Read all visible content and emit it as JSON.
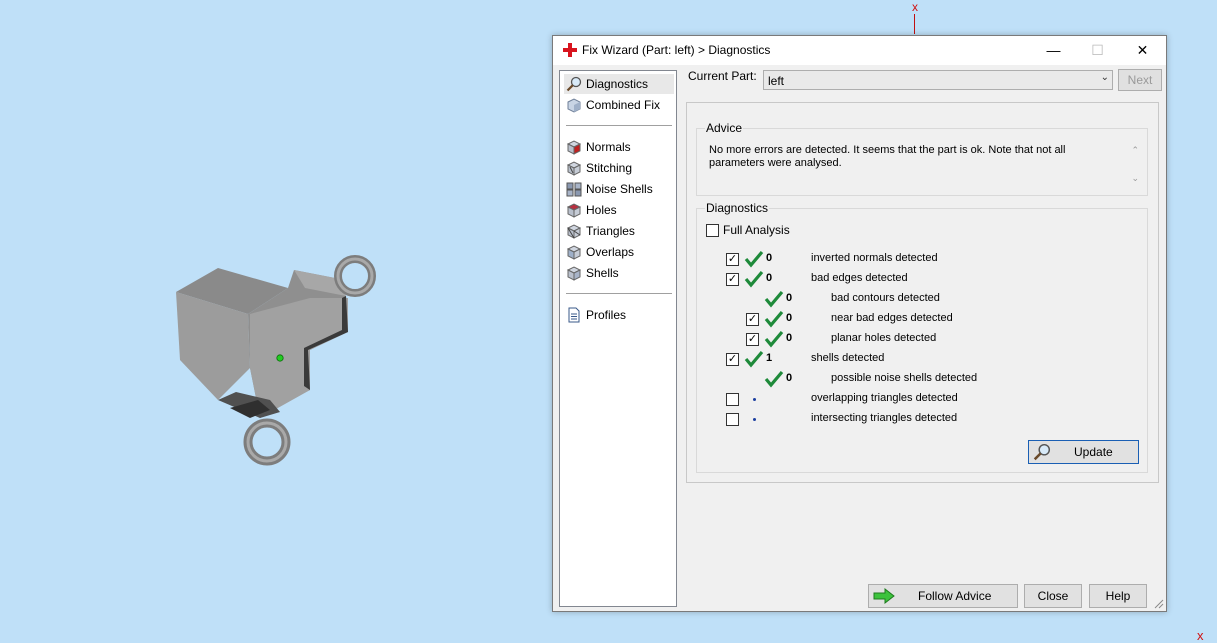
{
  "viewport": {
    "axis_top": "x",
    "axis_corner": "x"
  },
  "window": {
    "title": "Fix Wizard (Part: left) > Diagnostics",
    "controls": {
      "minimize": "—",
      "maximize": "☐",
      "close": "✕"
    }
  },
  "nav": {
    "items": [
      {
        "label": "Diagnostics",
        "icon": "magnifier-icon"
      },
      {
        "label": "Combined Fix",
        "icon": "combined-fix-icon"
      },
      {
        "label": "Normals",
        "icon": "normals-cube-icon"
      },
      {
        "label": "Stitching",
        "icon": "stitching-cube-icon"
      },
      {
        "label": "Noise Shells",
        "icon": "noise-shells-icon"
      },
      {
        "label": "Holes",
        "icon": "holes-cube-icon"
      },
      {
        "label": "Triangles",
        "icon": "triangles-cube-icon"
      },
      {
        "label": "Overlaps",
        "icon": "overlaps-cube-icon"
      },
      {
        "label": "Shells",
        "icon": "shells-cube-icon"
      },
      {
        "label": "Profiles",
        "icon": "profiles-document-icon"
      }
    ]
  },
  "current_part": {
    "label": "Current Part:",
    "value": "left",
    "next_label": "Next"
  },
  "advice": {
    "title": "Advice",
    "text": "No more errors are detected. It seems that the part is ok. Note that not all parameters were analysed."
  },
  "diagnostics": {
    "title": "Diagnostics",
    "full_analysis_label": "Full Analysis",
    "rows": [
      {
        "checked": true,
        "status": "check",
        "count": "0",
        "label": "inverted normals detected"
      },
      {
        "checked": true,
        "status": "check",
        "count": "0",
        "label": "bad edges detected"
      },
      {
        "checked": null,
        "status": "check",
        "count": "0",
        "label": "bad contours detected"
      },
      {
        "checked": true,
        "status": "check",
        "count": "0",
        "label": "near bad edges detected"
      },
      {
        "checked": true,
        "status": "check",
        "count": "0",
        "label": "planar holes detected"
      },
      {
        "checked": true,
        "status": "check",
        "count": "1",
        "label": "shells detected"
      },
      {
        "checked": null,
        "status": "check",
        "count": "0",
        "label": "possible noise shells detected"
      },
      {
        "checked": false,
        "status": "dot",
        "count": "",
        "label": "overlapping triangles detected"
      },
      {
        "checked": false,
        "status": "dot",
        "count": "",
        "label": "intersecting triangles detected"
      }
    ],
    "update_label": "Update"
  },
  "footer": {
    "follow_advice_label": "Follow Advice",
    "close_label": "Close",
    "help_label": "Help"
  },
  "colors": {
    "viewport_bg": "#bfe0f8",
    "check_green": "#1e8a3a",
    "axis_red": "#d01010"
  }
}
